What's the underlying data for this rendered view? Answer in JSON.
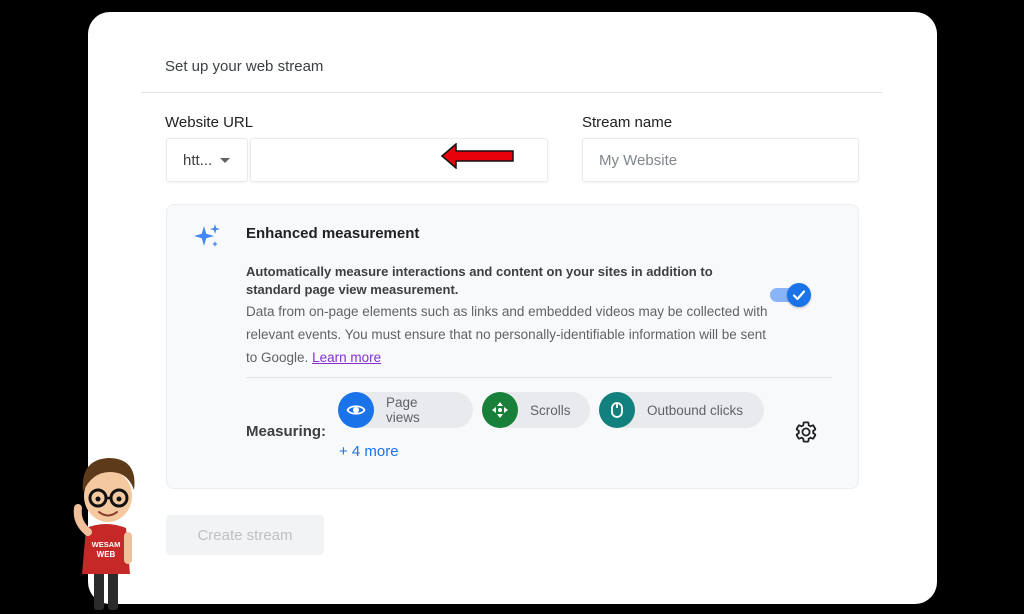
{
  "header": {
    "title": "Set up your web stream"
  },
  "form": {
    "url_label": "Website URL",
    "protocol_value": "htt...",
    "url_value": "",
    "name_label": "Stream name",
    "name_placeholder": "My Website"
  },
  "enhanced": {
    "title": "Enhanced measurement",
    "description_bold": "Automatically measure interactions and content on your sites in addition to standard page view measurement.",
    "description": "Data from on-page elements such as links and embedded videos may be collected with relevant events. You must ensure that no personally-identifiable information will be sent to Google.",
    "learn_more": "Learn more",
    "toggle_on": true,
    "measuring_label": "Measuring:",
    "chips": [
      {
        "label": "Page views",
        "icon": "eye-icon",
        "color": "#1a73e8"
      },
      {
        "label": "Scrolls",
        "icon": "scroll-arrows-icon",
        "color": "#188038"
      },
      {
        "label": "Outbound clicks",
        "icon": "mouse-icon",
        "color": "#12817d"
      }
    ],
    "more_link": "+ 4 more"
  },
  "actions": {
    "create_stream": "Create stream"
  },
  "mascot": {
    "shirt_text": "WESAM WEB"
  },
  "colors": {
    "accent": "#1a73e8",
    "arrow": "#e8000b",
    "link_visited": "#8430ce"
  }
}
